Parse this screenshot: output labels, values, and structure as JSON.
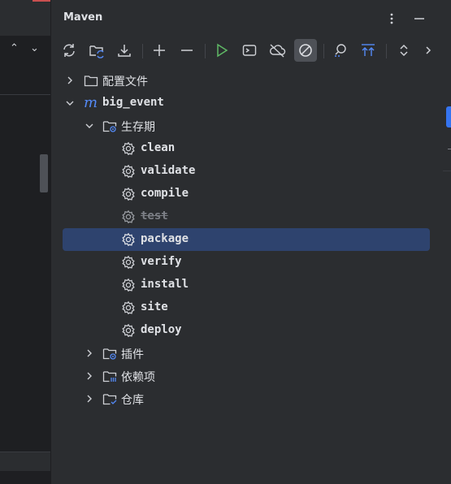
{
  "panel": {
    "title": "Maven",
    "more_icon": "more-vertical-icon",
    "minimize_icon": "minimize-icon"
  },
  "toolbar": {
    "buttons": [
      {
        "name": "reload-all-projects-button",
        "icon": "refresh-icon"
      },
      {
        "name": "generate-sources-button",
        "icon": "folder-refresh-icon"
      },
      {
        "name": "download-sources-button",
        "icon": "download-icon"
      },
      {
        "name": "add-project-button",
        "icon": "plus-icon"
      },
      {
        "name": "remove-project-button",
        "icon": "minus-icon"
      },
      {
        "name": "run-maven-build-button",
        "icon": "run-icon"
      },
      {
        "name": "execute-goal-button",
        "icon": "terminal-icon"
      },
      {
        "name": "toggle-offline-mode-button",
        "icon": "cloud-off-icon"
      },
      {
        "name": "skip-tests-button",
        "icon": "skip-tests-icon",
        "active": true
      },
      {
        "name": "show-dependencies-button",
        "icon": "analyze-icon"
      },
      {
        "name": "collapse-all-button",
        "icon": "collapse-icon"
      },
      {
        "name": "expand-collapse-button",
        "icon": "expand-collapse-icon"
      },
      {
        "name": "more-toolbar-button",
        "icon": "chevron-right-icon"
      }
    ]
  },
  "tree": {
    "profiles": {
      "label": "配置文件"
    },
    "project": {
      "label": "big_event"
    },
    "lifecycle": {
      "label": "生存期",
      "goals": [
        {
          "label": "clean"
        },
        {
          "label": "validate"
        },
        {
          "label": "compile"
        },
        {
          "label": "test",
          "skipped": true
        },
        {
          "label": "package",
          "selected": true
        },
        {
          "label": "verify"
        },
        {
          "label": "install"
        },
        {
          "label": "site"
        },
        {
          "label": "deploy"
        }
      ]
    },
    "plugins": {
      "label": "插件"
    },
    "dependencies": {
      "label": "依赖项"
    },
    "repositories": {
      "label": "仓库"
    }
  },
  "colors": {
    "background": "#2b2d30",
    "selection": "#2e436e",
    "accent": "#3574f0",
    "run_green": "#5fb865",
    "text": "#dfe1e5"
  }
}
